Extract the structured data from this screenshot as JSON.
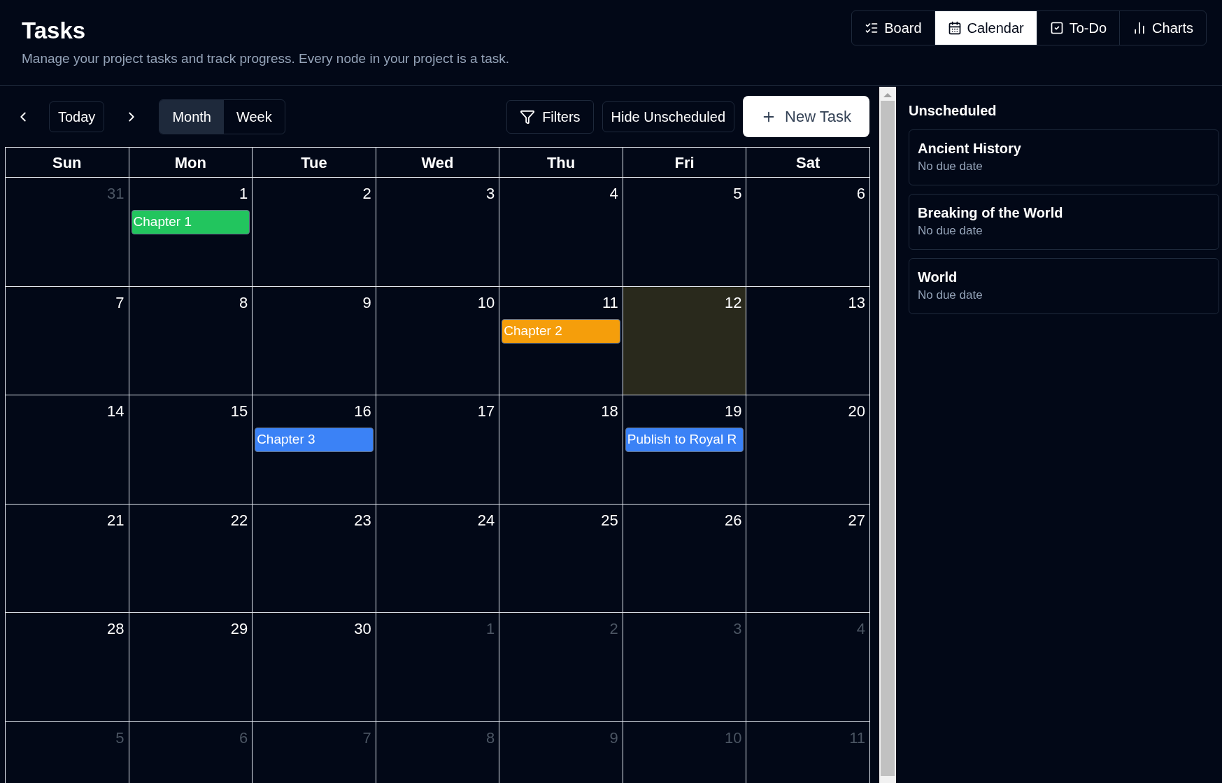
{
  "header": {
    "title": "Tasks",
    "subtitle": "Manage your project tasks and track progress. Every node in your project is a task."
  },
  "views": [
    {
      "label": "Board",
      "selected": false
    },
    {
      "label": "Calendar",
      "selected": true
    },
    {
      "label": "To-Do",
      "selected": false
    },
    {
      "label": "Charts",
      "selected": false
    }
  ],
  "toolbar": {
    "today": "Today",
    "modes": [
      {
        "label": "Month",
        "selected": true
      },
      {
        "label": "Week",
        "selected": false
      }
    ],
    "filters": "Filters",
    "hide_unscheduled": "Hide Unscheduled",
    "new_task": "New Task"
  },
  "calendar": {
    "weekdays": [
      "Sun",
      "Mon",
      "Tue",
      "Wed",
      "Thu",
      "Fri",
      "Sat"
    ],
    "weeks": [
      [
        {
          "day": "31",
          "dimmed": true,
          "highlighted": false
        },
        {
          "day": "1",
          "dimmed": false,
          "highlighted": false,
          "events": [
            {
              "title": "Chapter 1",
              "color": "#22c55e"
            }
          ]
        },
        {
          "day": "2",
          "dimmed": false,
          "highlighted": false
        },
        {
          "day": "3",
          "dimmed": false,
          "highlighted": false
        },
        {
          "day": "4",
          "dimmed": false,
          "highlighted": false
        },
        {
          "day": "5",
          "dimmed": false,
          "highlighted": false
        },
        {
          "day": "6",
          "dimmed": false,
          "highlighted": false
        }
      ],
      [
        {
          "day": "7",
          "dimmed": false,
          "highlighted": false
        },
        {
          "day": "8",
          "dimmed": false,
          "highlighted": false
        },
        {
          "day": "9",
          "dimmed": false,
          "highlighted": false
        },
        {
          "day": "10",
          "dimmed": false,
          "highlighted": false
        },
        {
          "day": "11",
          "dimmed": false,
          "highlighted": false,
          "events": [
            {
              "title": "Chapter 2",
              "color": "#f59e0b"
            }
          ]
        },
        {
          "day": "12",
          "dimmed": false,
          "highlighted": true
        },
        {
          "day": "13",
          "dimmed": false,
          "highlighted": false
        }
      ],
      [
        {
          "day": "14",
          "dimmed": false,
          "highlighted": false
        },
        {
          "day": "15",
          "dimmed": false,
          "highlighted": false
        },
        {
          "day": "16",
          "dimmed": false,
          "highlighted": false,
          "events": [
            {
              "title": "Chapter 3",
              "color": "#3b82f6"
            }
          ]
        },
        {
          "day": "17",
          "dimmed": false,
          "highlighted": false
        },
        {
          "day": "18",
          "dimmed": false,
          "highlighted": false
        },
        {
          "day": "19",
          "dimmed": false,
          "highlighted": false,
          "events": [
            {
              "title": "Publish to Royal R",
              "color": "#3b82f6"
            }
          ]
        },
        {
          "day": "20",
          "dimmed": false,
          "highlighted": false
        }
      ],
      [
        {
          "day": "21",
          "dimmed": false,
          "highlighted": false
        },
        {
          "day": "22",
          "dimmed": false,
          "highlighted": false
        },
        {
          "day": "23",
          "dimmed": false,
          "highlighted": false
        },
        {
          "day": "24",
          "dimmed": false,
          "highlighted": false
        },
        {
          "day": "25",
          "dimmed": false,
          "highlighted": false
        },
        {
          "day": "26",
          "dimmed": false,
          "highlighted": false
        },
        {
          "day": "27",
          "dimmed": false,
          "highlighted": false
        }
      ],
      [
        {
          "day": "28",
          "dimmed": false,
          "highlighted": false
        },
        {
          "day": "29",
          "dimmed": false,
          "highlighted": false
        },
        {
          "day": "30",
          "dimmed": false,
          "highlighted": false
        },
        {
          "day": "1",
          "dimmed": true,
          "highlighted": false
        },
        {
          "day": "2",
          "dimmed": true,
          "highlighted": false
        },
        {
          "day": "3",
          "dimmed": true,
          "highlighted": false
        },
        {
          "day": "4",
          "dimmed": true,
          "highlighted": false
        }
      ],
      [
        {
          "day": "5",
          "dimmed": true,
          "highlighted": false
        },
        {
          "day": "6",
          "dimmed": true,
          "highlighted": false
        },
        {
          "day": "7",
          "dimmed": true,
          "highlighted": false
        },
        {
          "day": "8",
          "dimmed": true,
          "highlighted": false
        },
        {
          "day": "9",
          "dimmed": true,
          "highlighted": false
        },
        {
          "day": "10",
          "dimmed": true,
          "highlighted": false
        },
        {
          "day": "11",
          "dimmed": true,
          "highlighted": false
        }
      ]
    ]
  },
  "unscheduled": {
    "title": "Unscheduled",
    "items": [
      {
        "title": "Ancient History",
        "due": "No due date"
      },
      {
        "title": "Breaking of the World",
        "due": "No due date"
      },
      {
        "title": "World",
        "due": "No due date"
      }
    ]
  }
}
